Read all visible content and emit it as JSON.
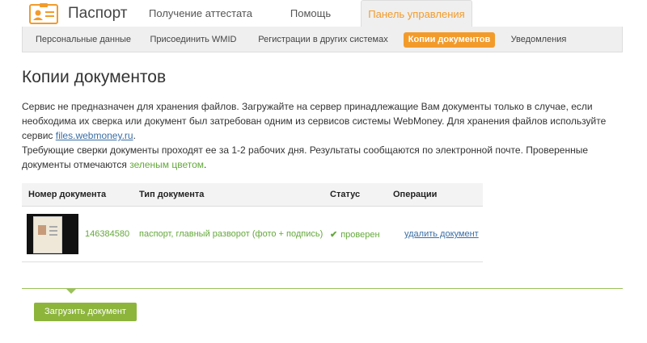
{
  "header": {
    "brand": "Паспорт",
    "tabs": [
      {
        "label": "Получение аттестата"
      },
      {
        "label": "Помощь"
      },
      {
        "label": "Панель управления"
      }
    ]
  },
  "subnav": {
    "items": [
      {
        "label": "Персональные данные"
      },
      {
        "label": "Присоединить WMID"
      },
      {
        "label": "Регистрации в других системах"
      },
      {
        "label": "Копии документов"
      },
      {
        "label": "Уведомления"
      }
    ]
  },
  "page": {
    "title": "Копии документов",
    "intro_part1": "Сервис не предназначен для хранения файлов. Загружайте на сервер принадлежащие Вам документы только в случае, если необходима их сверка или документ был затребован одним из сервисов системы WebMoney. Для хранения файлов используйте сервис ",
    "intro_link": "files.webmoney.ru",
    "intro_part2": ".",
    "intro2_part1": "Требующие сверки документы проходят ее за 1-2 рабочих дня. Результаты сообщаются по электронной почте. Проверенные документы отмечаются ",
    "intro2_green": "зеленым цветом",
    "intro2_part2": "."
  },
  "table": {
    "headers": {
      "number": "Номер документа",
      "type": "Тип документа",
      "status": "Статус",
      "operations": "Операции"
    },
    "rows": [
      {
        "number": "146384580",
        "type": "паспорт, главный разворот (фото + подпись)",
        "status": "проверен",
        "operation": "удалить документ"
      }
    ]
  },
  "actions": {
    "upload_label": "Загрузить документ"
  },
  "colors": {
    "accent_orange": "#f29b2b",
    "verified_green": "#64a83a",
    "button_green": "#8db53c",
    "link_blue": "#3a6ea5"
  }
}
